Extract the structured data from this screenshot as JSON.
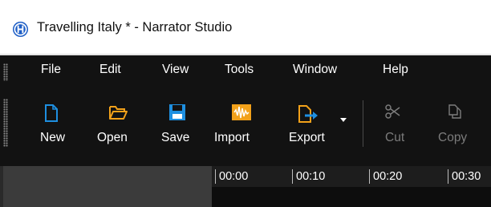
{
  "window": {
    "title": "Travelling Italy * - Narrator Studio",
    "icon": "narrator-app-icon"
  },
  "menubar": {
    "items": [
      {
        "label": "File"
      },
      {
        "label": "Edit"
      },
      {
        "label": "View"
      },
      {
        "label": "Tools"
      },
      {
        "label": "Window"
      },
      {
        "label": "Help"
      }
    ]
  },
  "toolbar": {
    "buttons": [
      {
        "label": "New",
        "icon": "new-file-icon",
        "enabled": true
      },
      {
        "label": "Open",
        "icon": "folder-open-icon",
        "enabled": true
      },
      {
        "label": "Save",
        "icon": "floppy-disk-icon",
        "enabled": true
      },
      {
        "label": "Import",
        "icon": "audio-waveform-icon",
        "enabled": true
      },
      {
        "label": "Export",
        "icon": "export-icon",
        "enabled": true,
        "has_dropdown": true
      },
      {
        "label": "Cut",
        "icon": "scissors-icon",
        "enabled": false
      },
      {
        "label": "Copy",
        "icon": "copy-icon",
        "enabled": false
      }
    ]
  },
  "timeline": {
    "ruler_ticks": [
      "00:00",
      "00:10",
      "00:20",
      "00:30"
    ]
  },
  "colors": {
    "toolbar_bg": "#121212",
    "icon_blue": "#1e8fe0",
    "icon_orange": "#f2a11a",
    "disabled_text": "#7c7c7c"
  }
}
